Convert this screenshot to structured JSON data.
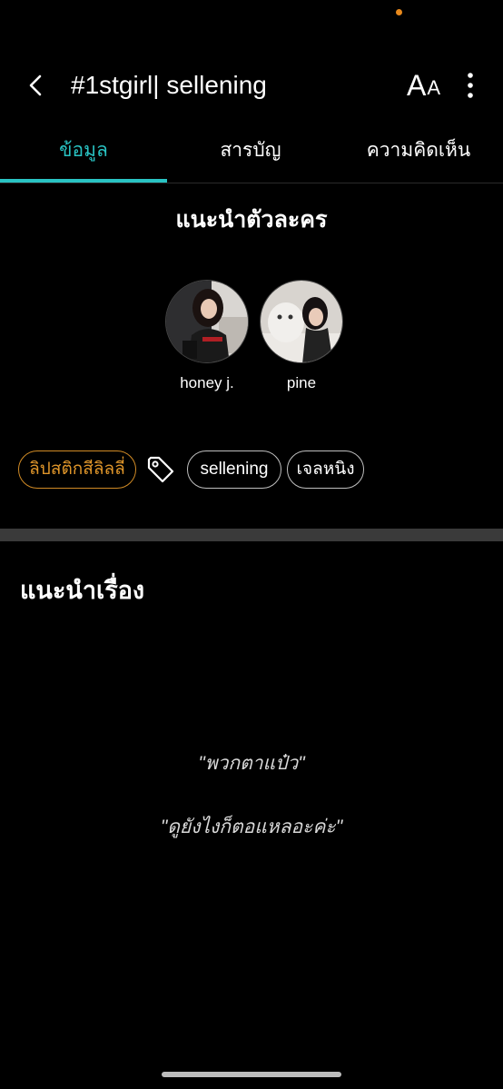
{
  "header": {
    "title": "#1stgirl| sellening",
    "font_size_big": "A",
    "font_size_small": "A",
    "back_icon": "chevron-left-icon",
    "more_icon": "more-vertical-icon"
  },
  "tabs": [
    {
      "label": "ข้อมูล",
      "active": true
    },
    {
      "label": "สารบัญ",
      "active": false
    },
    {
      "label": "ความคิดเห็น",
      "active": false
    }
  ],
  "characters_section": {
    "title": "แนะนำตัวละคร",
    "characters": [
      {
        "name": "honey j."
      },
      {
        "name": "pine"
      }
    ]
  },
  "tags": {
    "category": "ลิปสติกสีลิลลี่",
    "tag_icon": "tag-icon",
    "items": [
      "sellening",
      "เจลหนิง"
    ]
  },
  "intro_section": {
    "title": "แนะนำเรื่อง",
    "quotes": [
      "\"พวกตาแป๋ว\"",
      "\"ดูยังไงก็ตอแหลอะค่ะ\""
    ]
  },
  "colors": {
    "accent": "#29c3c3",
    "category": "#e0962a",
    "background": "#000000"
  }
}
